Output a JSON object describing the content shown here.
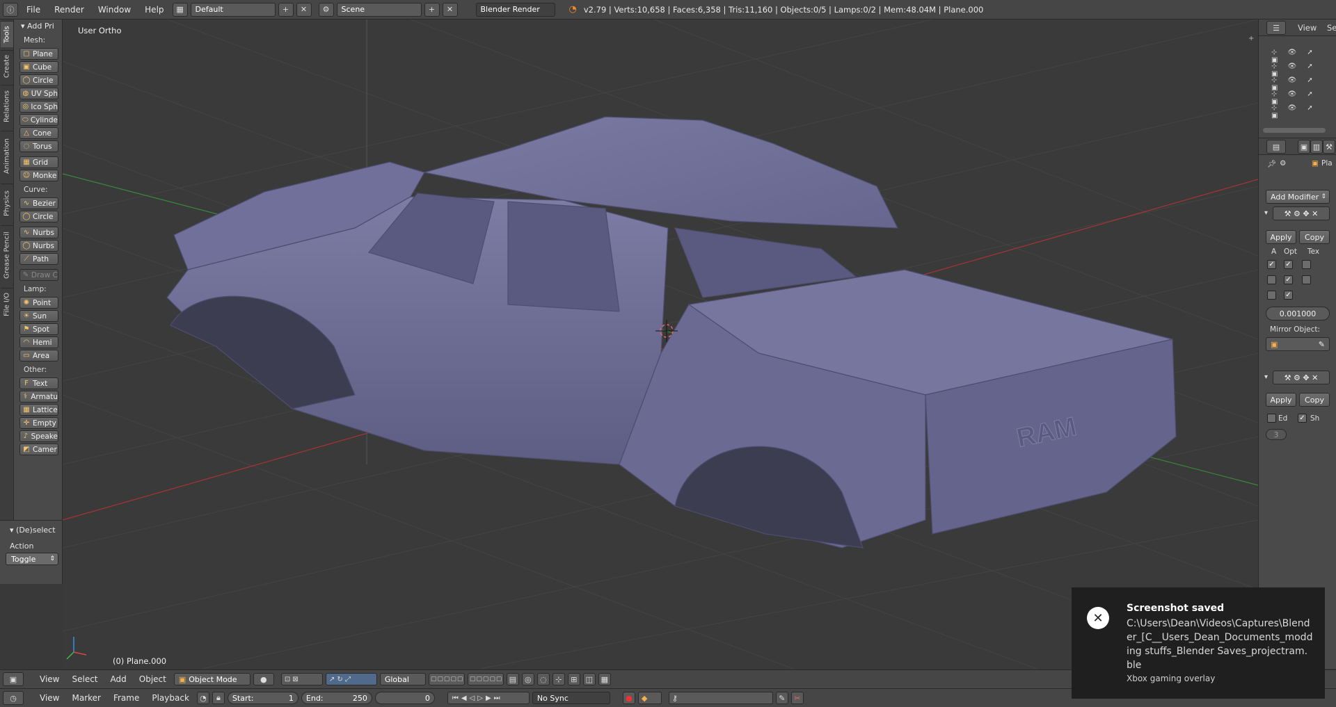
{
  "topbar": {
    "menus": [
      "File",
      "Render",
      "Window",
      "Help"
    ],
    "layout": "Default",
    "scene": "Scene",
    "engine": "Blender Render",
    "stats": "v2.79 | Verts:10,658 | Faces:6,358 | Tris:11,160 | Objects:0/5 | Lamps:0/2 | Mem:48.04M | Plane.000"
  },
  "tabs": [
    "Tools",
    "Create",
    "Relations",
    "Animation",
    "Physics",
    "Grease Pencil",
    "File I/O"
  ],
  "toolshelf": {
    "header": "Add Pri",
    "mesh_label": "Mesh:",
    "mesh": [
      "Plane",
      "Cube",
      "Circle",
      "UV Sph",
      "Ico Sph",
      "Cylinde",
      "Cone",
      "Torus",
      "Grid",
      "Monke"
    ],
    "curve_label": "Curve:",
    "curve": [
      "Bezier",
      "Circle",
      "Nurbs",
      "Nurbs",
      "Path"
    ],
    "draw_label": "Draw C",
    "lamp_label": "Lamp:",
    "lamp": [
      "Point",
      "Sun",
      "Spot",
      "Hemi",
      "Area"
    ],
    "other_label": "Other:",
    "other": [
      "Text",
      "Armatu",
      "Lattice",
      "Empty",
      "Speake",
      "Camer"
    ]
  },
  "operator": {
    "header": "(De)select",
    "action_label": "Action",
    "action_value": "Toggle"
  },
  "viewport": {
    "view_name": "User Ortho",
    "object_name": "(0) Plane.000",
    "badge": "RAM"
  },
  "outliner": {
    "view_menu": "View",
    "search_menu": "Se"
  },
  "properties": {
    "object_short": "Pla",
    "add_modifier": "Add Modifier",
    "apply": "Apply",
    "copy": "Copy",
    "col_a": "A",
    "col_opt": "Opt",
    "col_tex": "Tex",
    "merge_value": "0.001000",
    "mirror_object": "Mirror Object:",
    "apply2": "Apply",
    "copy2": "Copy",
    "ed_label": "Ed",
    "sh_label": "Sh",
    "levels": "3"
  },
  "view3d_header": {
    "menus": [
      "View",
      "Select",
      "Add",
      "Object"
    ],
    "mode": "Object Mode",
    "orientation": "Global"
  },
  "timeline_header": {
    "menus": [
      "View",
      "Marker",
      "Frame",
      "Playback"
    ],
    "start_label": "Start:",
    "start_value": "1",
    "end_label": "End:",
    "end_value": "250",
    "current_frame": "0",
    "sync": "No Sync"
  },
  "toast": {
    "title": "Screenshot saved",
    "body": "C:\\Users\\Dean\\Videos\\Captures\\Blender_[C__Users_Dean_Documents_modding stuffs_Blender Saves_projectram.ble",
    "source": "Xbox gaming overlay"
  },
  "colors": {
    "viewport_bg": "#3a3a3a",
    "mesh": "#6e6e96",
    "x_axis": "#b03a3a",
    "y_axis": "#3a9a3a",
    "panel": "#4a4a4a"
  }
}
